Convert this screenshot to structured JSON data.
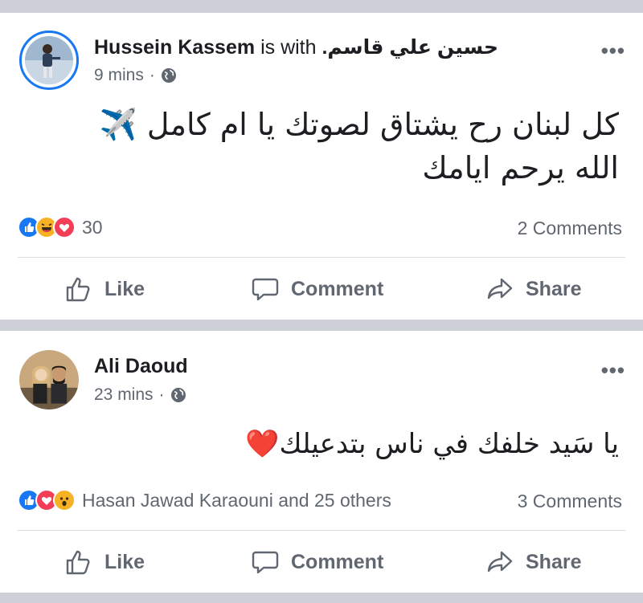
{
  "posts": [
    {
      "author": "Hussein Kassem",
      "with_text": "is with",
      "tagged": "حسين علي قاسم.",
      "time": "9 mins",
      "privacy_icon": "globe-icon",
      "text_line1": "كل لبنان رح يشتاق لصوتك يا ام كامل ✈️",
      "text_line2": "الله يرحم ايامك",
      "reactions": [
        "like",
        "haha",
        "love"
      ],
      "reaction_count": "30",
      "comments": "2 Comments",
      "actions": {
        "like": "Like",
        "comment": "Comment",
        "share": "Share"
      }
    },
    {
      "author": "Ali Daoud",
      "time": "23 mins",
      "privacy_icon": "globe-icon",
      "text_line1": "يا سَيد خلفك في ناس بتدعيلك❤️",
      "reactions": [
        "like",
        "love",
        "wow"
      ],
      "reaction_count": "Hasan Jawad Karaouni and 25 others",
      "comments": "3 Comments",
      "actions": {
        "like": "Like",
        "comment": "Comment",
        "share": "Share"
      }
    }
  ],
  "colors": {
    "like": "#1877f2",
    "love": "#f33e58",
    "haha": "#f7b125",
    "secondary_text": "#606770",
    "divider": "#dadde1",
    "feed_bg": "#cdd0d6"
  }
}
